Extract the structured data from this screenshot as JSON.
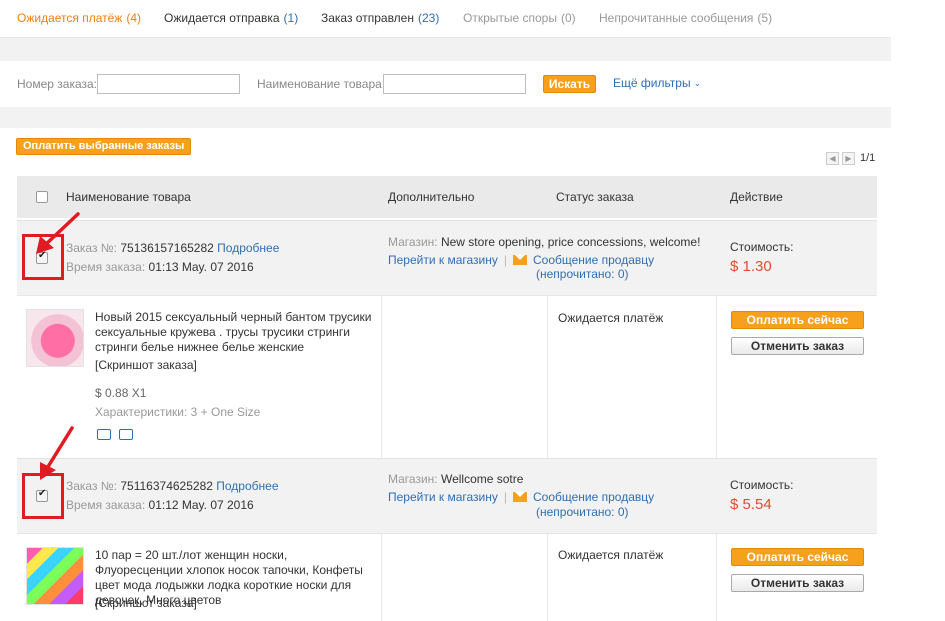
{
  "tabs": [
    {
      "label": "Ожидается платёж",
      "count": "(4)"
    },
    {
      "label": "Ожидается отправка",
      "count": "(1)"
    },
    {
      "label": "Заказ отправлен",
      "count": "(23)"
    },
    {
      "label": "Открытые споры",
      "count": "(0)"
    },
    {
      "label": "Непрочитанные сообщения",
      "count": "(5)"
    }
  ],
  "filter": {
    "order_no_label": "Номер заказа:",
    "order_no_value": "",
    "product_label": "Наименование товара:",
    "product_value": "",
    "search_label": "Искать",
    "more_filters_label": "Ещё фильтры"
  },
  "pay_selected_label": "Оплатить выбранные заказы",
  "pager": {
    "text": "1/1"
  },
  "table_header": {
    "product": "Наименование товара",
    "extra": "Дополнительно",
    "status": "Статус заказа",
    "action": "Действие"
  },
  "orders": [
    {
      "order_label": "Заказ №:",
      "order_no": "75136157165282",
      "details_link": "Подробнее",
      "time_label": "Время заказа:",
      "time": "01:13 May. 07 2016",
      "shop_label": "Магазин:",
      "shop_name": "New store opening, price concessions, welcome!",
      "go_to_shop": "Перейти к магазину",
      "message_seller": "Сообщение продавцу",
      "unread": "(непрочитано: 0)",
      "cost_label": "Стоимость:",
      "cost": "$ 1.30",
      "product_title": "Новый 2015 сексуальный черный бантом трусики сексуальные кружева . трусы трусики стринги стринги белье нижнее белье женские",
      "snapshot": "[Скриншот заказа]",
      "price": "$ 0.88 X1",
      "props": "Характеристики: 3 + One Size",
      "status": "Ожидается платёж",
      "pay_now": "Оплатить сейчас",
      "cancel": "Отменить заказ"
    },
    {
      "order_label": "Заказ №:",
      "order_no": "75116374625282",
      "details_link": "Подробнее",
      "time_label": "Время заказа:",
      "time": "01:12 May. 07 2016",
      "shop_label": "Магазин:",
      "shop_name": "Wellcome sotre",
      "go_to_shop": "Перейти к магазину",
      "message_seller": "Сообщение продавцу",
      "unread": "(непрочитано: 0)",
      "cost_label": "Стоимость:",
      "cost": "$ 5.54",
      "product_title": "10 пар = 20 шт./лот женщин носки, Флуоресценции хлопок носок тапочки, Конфеты цвет мода лодыжки лодка короткие носки для девочек, Много цветов",
      "snapshot": "[Скриншот заказа]",
      "status": "Ожидается платёж",
      "pay_now": "Оплатить сейчас",
      "cancel": "Отменить заказ"
    }
  ],
  "colors": {
    "accent": "#f7a01c",
    "active_tab": "#f07e0d",
    "link": "#2d6fb5",
    "price": "#e34b2f",
    "annotation": "#e11b22"
  }
}
